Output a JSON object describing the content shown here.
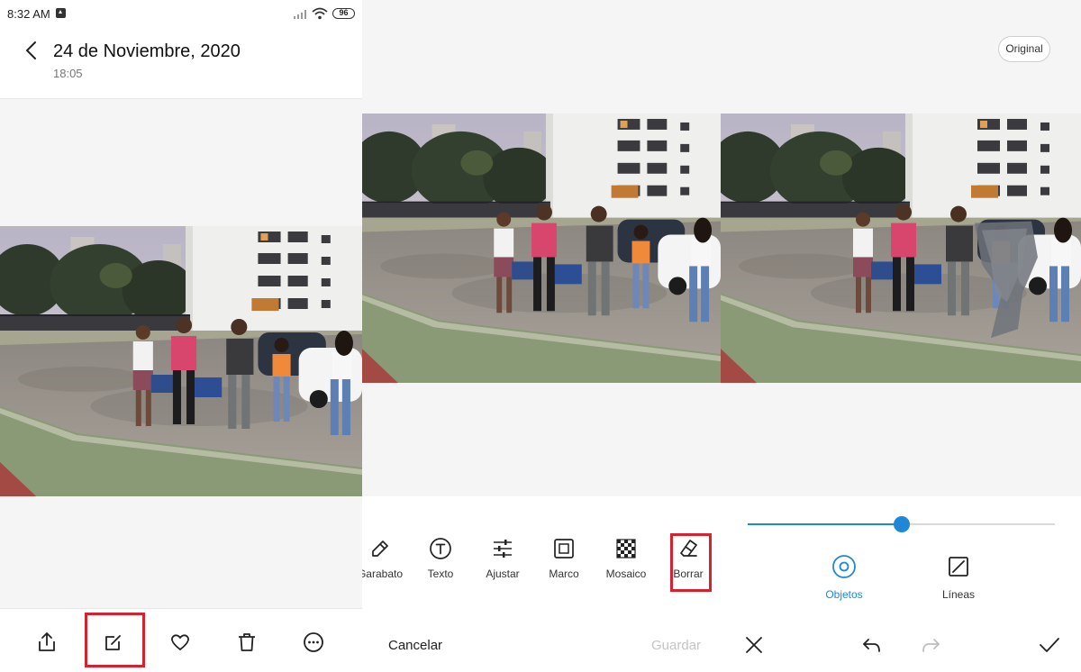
{
  "status_bar": {
    "time": "8:32 AM",
    "battery": "96"
  },
  "gallery": {
    "title": "24 de Noviembre, 2020",
    "subtitle": "18:05",
    "toolbar_icons": [
      "share-icon",
      "edit-icon",
      "heart-icon",
      "trash-icon",
      "more-icon"
    ]
  },
  "editor": {
    "tools": [
      {
        "label": "Garabato",
        "icon": "pen-icon"
      },
      {
        "label": "Texto",
        "icon": "text-icon"
      },
      {
        "label": "Ajustar",
        "icon": "sliders-icon"
      },
      {
        "label": "Marco",
        "icon": "frame-icon"
      },
      {
        "label": "Mosaico",
        "icon": "mosaic-icon"
      },
      {
        "label": "Borrar",
        "icon": "eraser-icon"
      }
    ],
    "cancel": "Cancelar",
    "save": "Guardar"
  },
  "erase": {
    "original": "Original",
    "brush_size_fraction": 0.5,
    "modes": [
      {
        "label": "Objetos",
        "icon": "target-icon",
        "active": true
      },
      {
        "label": "Líneas",
        "icon": "line-icon",
        "active": false
      }
    ]
  },
  "colors": {
    "highlight": "#d6212e",
    "accent": "#1e88d6",
    "disabled": "#c4c4c4"
  }
}
